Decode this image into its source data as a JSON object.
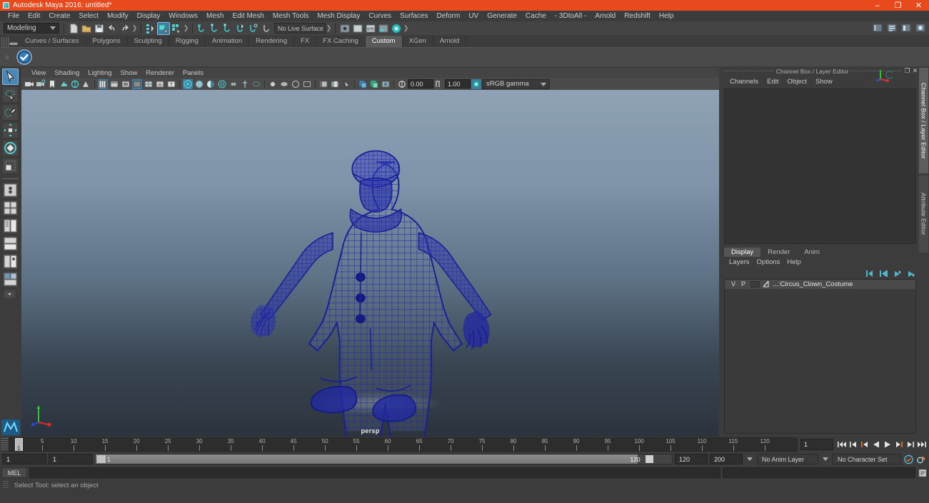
{
  "window": {
    "title": "Autodesk Maya 2016: untitled*",
    "app_icon": "maya-icon",
    "minimize": "–",
    "maximize": "❐",
    "close": "✕"
  },
  "menubar": {
    "items": [
      "File",
      "Edit",
      "Create",
      "Select",
      "Modify",
      "Display",
      "Windows",
      "Mesh",
      "Edit Mesh",
      "Mesh Tools",
      "Mesh Display",
      "Curves",
      "Surfaces",
      "Deform",
      "UV",
      "Generate",
      "Cache",
      "- 3DtoAll -",
      "Arnold",
      "Redshift",
      "Help"
    ]
  },
  "statusline": {
    "mode": "Modeling",
    "live_surface": "No Live Surface",
    "selection_mask_selected_index": 1,
    "icons": [
      "new-scene-icon",
      "open-scene-icon",
      "save-scene-icon",
      "undo-icon",
      "redo-icon",
      "select-by-hierarchy-icon",
      "select-by-object-icon",
      "select-by-component-icon",
      "snap-to-grid-icon",
      "snap-to-curve-icon",
      "snap-to-point-icon",
      "snap-to-projected-center-icon",
      "snap-to-view-plane-icon",
      "make-live-icon",
      "show-hide-editor-icon",
      "render-view-icon",
      "ipr-render-icon",
      "render-settings-icon",
      "hypershade-icon"
    ],
    "right_icons": [
      "sidebar-toggle-icon",
      "attribute-editor-toggle-icon",
      "tool-settings-toggle-icon",
      "channel-box-toggle-icon"
    ]
  },
  "shelf": {
    "tabs": [
      "Curves / Surfaces",
      "Polygons",
      "Sculpting",
      "Rigging",
      "Animation",
      "Rendering",
      "FX",
      "FX Caching",
      "Custom",
      "XGen",
      "Arnold"
    ],
    "active_tab": "Custom",
    "items": [
      "check-mark-shelf-icon"
    ]
  },
  "toolbox": {
    "tools": [
      {
        "name": "select-tool",
        "active": true
      },
      {
        "name": "lasso-select-tool",
        "active": false
      },
      {
        "name": "paint-select-tool",
        "active": false
      },
      {
        "name": "move-tool",
        "active": false
      },
      {
        "name": "rotate-tool",
        "active": false
      },
      {
        "name": "scale-tool",
        "active": false
      },
      {
        "name": "last-tool-used",
        "active": false
      }
    ],
    "layouts": [
      {
        "name": "single-perspective-layout"
      },
      {
        "name": "four-view-layout"
      },
      {
        "name": "persp-outliner-layout"
      },
      {
        "name": "persp-graph-layout"
      },
      {
        "name": "hypershade-persp-layout"
      },
      {
        "name": "persp-hypergraph-layout"
      }
    ],
    "logo": "maya-logo"
  },
  "viewport": {
    "panel_menus": [
      "View",
      "Shading",
      "Lighting",
      "Show",
      "Renderer",
      "Panels"
    ],
    "camera_label": "persp",
    "exposure_value": "0.00",
    "gamma_value": "1.00",
    "color_management": "sRGB gamma",
    "toolbar_icons": [
      "select-camera-icon",
      "camera-attributes-icon",
      "bookmark-icon",
      "image-plane-icon",
      "two-sided-lighting-icon",
      "shadows-icon",
      "wireframe-icon",
      "smooth-shade-all-icon",
      "smooth-shade-selected-icon",
      "shaded-texture-icon",
      "wireframe-on-shaded-icon",
      "xray-icon",
      "xray-joints-icon",
      "use-default-lighting-icon",
      "use-all-lights-icon",
      "shadows-toggle-icon",
      "ambient-occlusion-icon",
      "motion-blur-icon",
      "multisample-icon",
      "dof-icon",
      "isolate-select-icon",
      "grid-toggle-icon",
      "film-gate-icon",
      "resolution-gate-icon",
      "gate-mask-icon",
      "exposure-icon",
      "gamma-icon",
      "color-management-icon"
    ],
    "model_description": "Circus clown costume wireframe mesh",
    "wireframe_color": "#1c1f9b",
    "bg_top": "#8fa2b5",
    "bg_bottom": "#2b333d",
    "axis_labels": {
      "x": "x",
      "y": "y",
      "z": "z"
    }
  },
  "channelbox": {
    "panel_title": "Channel Box / Layer Editor",
    "menus": [
      "Channels",
      "Edit",
      "Object",
      "Show"
    ],
    "float_icon": "undock-icon",
    "close_icon": "close-icon",
    "empty": ""
  },
  "sidetabs": {
    "items": [
      {
        "label": "Channel Box / Layer Editor",
        "active": true
      },
      {
        "label": "Attribute Editor",
        "active": false
      }
    ]
  },
  "layereditor": {
    "tabs": [
      "Display",
      "Render",
      "Anim"
    ],
    "active_tab": "Display",
    "menus": [
      "Layers",
      "Options",
      "Help"
    ],
    "buttons": [
      "new-layer-icon",
      "new-layer-from-selected-icon",
      "move-layer-up-icon",
      "move-layer-down-icon"
    ],
    "layers": [
      {
        "visibility": "V",
        "playback": "P",
        "color": "",
        "name": "...:Circus_Clown_Costume"
      }
    ]
  },
  "timeslider": {
    "current_frame": "1",
    "cursor_label": "1",
    "start": 1,
    "end": 120,
    "tick_labels": [
      "5",
      "10",
      "15",
      "20",
      "25",
      "30",
      "35",
      "40",
      "45",
      "50",
      "55",
      "60",
      "65",
      "70",
      "75",
      "80",
      "85",
      "90",
      "95",
      "100",
      "105",
      "110",
      "115",
      "120"
    ],
    "playback_buttons": [
      "go-to-start-icon",
      "step-back-frame-icon",
      "step-back-key-icon",
      "play-backwards-icon",
      "play-forwards-icon",
      "step-forward-key-icon",
      "step-forward-frame-icon",
      "go-to-end-icon"
    ]
  },
  "rangeslider": {
    "anim_start": "1",
    "range_start": "1",
    "range_bar_left_label": "1",
    "range_bar_right_label": "120",
    "range_end": "120",
    "anim_end": "200",
    "anim_layer": "No Anim Layer",
    "character_set": "No Character Set",
    "auto_key_icon": "auto-keyframe-icon",
    "prefs_icon": "animation-preferences-icon"
  },
  "commandline": {
    "language_label": "MEL",
    "input_value": "",
    "output_value": "",
    "script_editor_icon": "script-editor-icon"
  },
  "helpline": {
    "text": "Select Tool: select an object"
  }
}
